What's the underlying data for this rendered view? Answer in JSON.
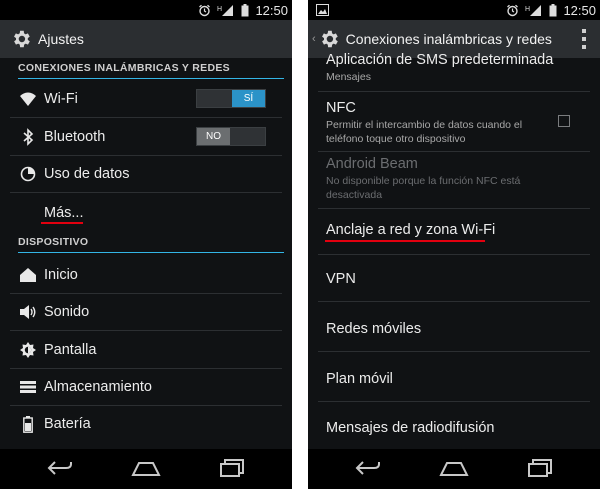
{
  "left": {
    "status": {
      "time": "12:50",
      "signal_label": "H"
    },
    "actionbar": {
      "title": "Ajustes",
      "icon": "gear-icon"
    },
    "sections": {
      "wireless": "CONEXIONES INALÁMBRICAS Y REDES",
      "device": "DISPOSITIVO"
    },
    "items": [
      {
        "label": "Wi-Fi",
        "icon": "wifi-icon",
        "toggle": "SÍ",
        "toggle_state": "on"
      },
      {
        "label": "Bluetooth",
        "icon": "bluetooth-icon",
        "toggle": "NO",
        "toggle_state": "off"
      },
      {
        "label": "Uso de datos",
        "icon": "data-usage-icon"
      },
      {
        "label": "Más...",
        "icon": ""
      },
      {
        "label": "Inicio",
        "icon": "home-icon"
      },
      {
        "label": "Sonido",
        "icon": "sound-icon"
      },
      {
        "label": "Pantalla",
        "icon": "display-icon"
      },
      {
        "label": "Almacenamiento",
        "icon": "storage-icon"
      },
      {
        "label": "Batería",
        "icon": "battery-icon"
      }
    ]
  },
  "right": {
    "status": {
      "time": "12:50",
      "signal_label": "H"
    },
    "actionbar": {
      "title": "Conexiones inalámbricas y redes",
      "icon": "gear-icon"
    },
    "items": [
      {
        "title": "Aplicación de SMS predeterminada",
        "subtitle": "Mensajes"
      },
      {
        "title": "NFC",
        "subtitle": "Permitir el intercambio de datos cuando el teléfono toque otro dispositivo",
        "checkbox": false
      },
      {
        "title": "Android Beam",
        "subtitle": "No disponible porque la función NFC está desactivada",
        "disabled": true
      },
      {
        "title": "Anclaje a red y zona Wi-Fi"
      },
      {
        "title": "VPN"
      },
      {
        "title": "Redes móviles"
      },
      {
        "title": "Plan móvil"
      },
      {
        "title": "Mensajes de radiodifusión"
      }
    ]
  },
  "colors": {
    "accent_blue": "#33b5e5",
    "toggle_on": "#2b93c8",
    "highlight_underline": "#e3000f",
    "background": "#101214",
    "actionbar": "#2b2e31"
  }
}
